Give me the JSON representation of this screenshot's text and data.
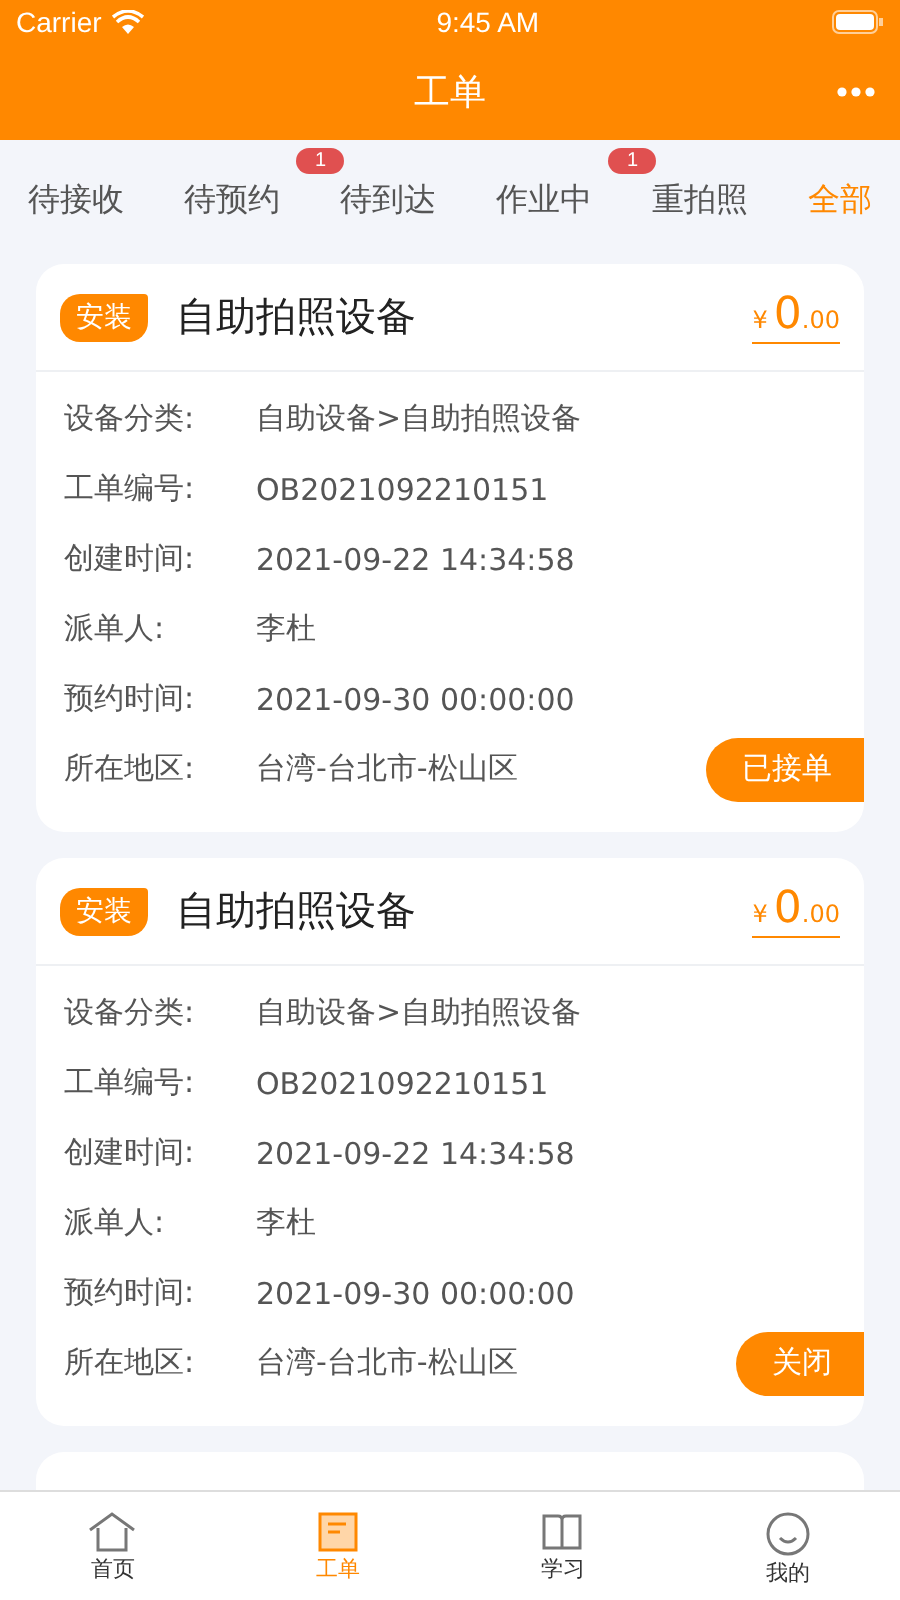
{
  "status_bar": {
    "carrier": "Carrier",
    "time": "9:45 AM"
  },
  "nav": {
    "title": "工单"
  },
  "tabs": [
    {
      "label": "待接收",
      "selected": false
    },
    {
      "label": "待预约",
      "selected": false,
      "badge": "1"
    },
    {
      "label": "待到达",
      "selected": false
    },
    {
      "label": "作业中",
      "selected": false,
      "badge": "1"
    },
    {
      "label": "重拍照",
      "selected": false
    },
    {
      "label": "全部",
      "selected": true
    }
  ],
  "orders": [
    {
      "tag": "安装",
      "title": "自助拍照设备",
      "currency": "¥",
      "price_int": "0",
      "price_dec": ".00",
      "fields": [
        {
          "label": "设备分类:",
          "value": "自助设备>自助拍照设备"
        },
        {
          "label": "工单编号:",
          "value": "OB2021092210151"
        },
        {
          "label": "创建时间:",
          "value": "2021-09-22 14:34:58"
        },
        {
          "label": "派单人:",
          "value": "李杜"
        },
        {
          "label": "预约时间:",
          "value": "2021-09-30 00:00:00"
        },
        {
          "label": "所在地区:",
          "value": "台湾-台北市-松山区"
        }
      ],
      "action": "已接单"
    },
    {
      "tag": "安装",
      "title": "自助拍照设备",
      "currency": "¥",
      "price_int": "0",
      "price_dec": ".00",
      "fields": [
        {
          "label": "设备分类:",
          "value": "自助设备>自助拍照设备"
        },
        {
          "label": "工单编号:",
          "value": "OB2021092210151"
        },
        {
          "label": "创建时间:",
          "value": "2021-09-22 14:34:58"
        },
        {
          "label": "派单人:",
          "value": "李杜"
        },
        {
          "label": "预约时间:",
          "value": "2021-09-30 00:00:00"
        },
        {
          "label": "所在地区:",
          "value": "台湾-台北市-松山区"
        }
      ],
      "action": "关闭"
    }
  ],
  "tab_bar": [
    {
      "kind": "home",
      "label": "首页",
      "selected": false
    },
    {
      "kind": "orders",
      "label": "工单",
      "selected": true
    },
    {
      "kind": "study",
      "label": "学习",
      "selected": false
    },
    {
      "kind": "me",
      "label": "我的",
      "selected": false
    }
  ]
}
